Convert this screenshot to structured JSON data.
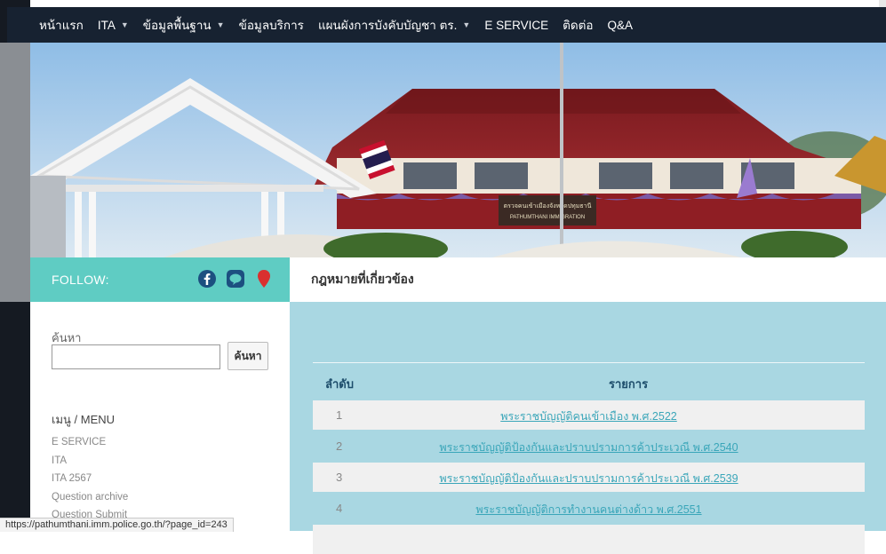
{
  "nav": {
    "items": [
      {
        "label": "หน้าแรก",
        "dropdown": false
      },
      {
        "label": "ITA",
        "dropdown": true
      },
      {
        "label": "ข้อมูลพื้นฐาน",
        "dropdown": true
      },
      {
        "label": "ข้อมูลบริการ",
        "dropdown": false
      },
      {
        "label": "แผนผังการบังคับบัญชา ตร.",
        "dropdown": true
      },
      {
        "label": "E SERVICE",
        "dropdown": false
      },
      {
        "label": "ติดต่อ",
        "dropdown": false
      },
      {
        "label": "Q&A",
        "dropdown": false
      }
    ]
  },
  "banner": {
    "sign_line1": "ตรวจคนเข้าเมืองจังหวัดปทุมธานี",
    "sign_line2": "PATHUMTHANI IMMIGRATION"
  },
  "follow": {
    "label": "FOLLOW:",
    "icons": [
      "facebook-icon",
      "line-icon",
      "location-pin-icon"
    ]
  },
  "page": {
    "title": "กฎหมายที่เกี่ยวข้อง"
  },
  "sidebar": {
    "search_label": "ค้นหา",
    "search_value": "",
    "search_button": "ค้นหา",
    "menu_title": "เมนู / MENU",
    "menu_items": [
      "E SERVICE",
      "ITA",
      "ITA 2567",
      "Question archive",
      "Question Submit"
    ]
  },
  "table": {
    "headers": {
      "index": "ลำดับ",
      "item": "รายการ"
    },
    "rows": [
      {
        "index": "1",
        "item": "พระราชบัญญัติคนเข้าเมือง พ.ศ.2522"
      },
      {
        "index": "2",
        "item": "พระราชบัญญัติป้องกันและปราบปรามการค้าประเวณี พ.ศ.2540"
      },
      {
        "index": "3",
        "item": "พระราชบัญญัติป้องกันและปราบปรามการค้าประเวณี พ.ศ.2539"
      },
      {
        "index": "4",
        "item": "พระราชบัญญัติการทำงานคนต่างด้าว พ.ศ.2551"
      }
    ]
  },
  "status_url": "https://pathumthani.imm.police.go.th/?page_id=243",
  "colors": {
    "navbar": "#172231",
    "follow_bar": "#5fccc3",
    "content_bg": "#a9d7e2",
    "link": "#3aa6b9"
  }
}
